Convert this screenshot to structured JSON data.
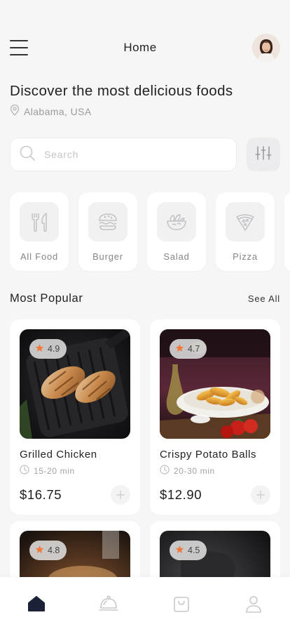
{
  "header": {
    "title": "Home",
    "menu_icon": "hamburger-menu-icon",
    "avatar_alt": "user avatar"
  },
  "hero": {
    "headline": "Discover the most delicious foods",
    "location": "Alabama, USA"
  },
  "search": {
    "placeholder": "Search",
    "value": ""
  },
  "categories": [
    {
      "label": "All Food",
      "icon": "fork-knife-icon"
    },
    {
      "label": "Burger",
      "icon": "burger-icon"
    },
    {
      "label": "Salad",
      "icon": "salad-bowl-icon"
    },
    {
      "label": "Pizza",
      "icon": "pizza-slice-icon"
    }
  ],
  "popular": {
    "title": "Most Popular",
    "see_all": "See All",
    "items": [
      {
        "name": "Grilled Chicken",
        "rating": "4.9",
        "time": "15-20 min",
        "price": "$16.75"
      },
      {
        "name": "Crispy Potato Balls",
        "rating": "4.7",
        "time": "20-30 min",
        "price": "$12.90"
      },
      {
        "name": "",
        "rating": "4.8",
        "time": "",
        "price": ""
      },
      {
        "name": "",
        "rating": "4.5",
        "time": "",
        "price": ""
      }
    ]
  },
  "bottom_nav": [
    {
      "name": "home",
      "active": true
    },
    {
      "name": "cloche",
      "active": false
    },
    {
      "name": "bag",
      "active": false
    },
    {
      "name": "profile",
      "active": false
    }
  ],
  "colors": {
    "accent_star": "#ef7a3b",
    "active_nav": "#1b2238",
    "inactive_nav": "#c8c8cc",
    "background": "#f6f6f7"
  }
}
